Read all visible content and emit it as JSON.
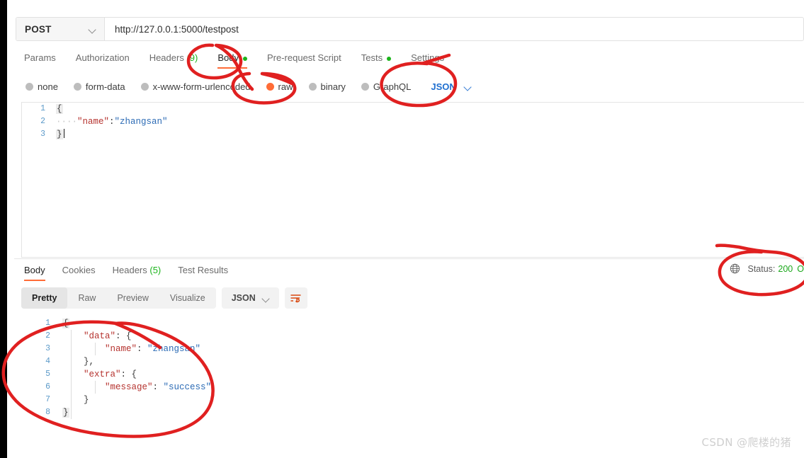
{
  "request": {
    "method": "POST",
    "url": "http://127.0.0.1:5000/testpost",
    "tabs": [
      {
        "label": "Params",
        "active": false,
        "dot": false
      },
      {
        "label": "Authorization",
        "active": false,
        "dot": false
      },
      {
        "label": "Headers",
        "count": "(9)",
        "active": false,
        "dot": false
      },
      {
        "label": "Body",
        "active": true,
        "dot": true
      },
      {
        "label": "Pre-request Script",
        "active": false,
        "dot": false
      },
      {
        "label": "Tests",
        "active": false,
        "dot": true
      },
      {
        "label": "Settings",
        "active": false,
        "dot": false
      }
    ],
    "body_types": [
      {
        "label": "none",
        "selected": false
      },
      {
        "label": "form-data",
        "selected": false
      },
      {
        "label": "x-www-form-urlencoded",
        "selected": false
      },
      {
        "label": "raw",
        "selected": true
      },
      {
        "label": "binary",
        "selected": false
      },
      {
        "label": "GraphQL",
        "selected": false
      }
    ],
    "raw_format": "JSON",
    "editor": {
      "line_numbers": [
        "1",
        "2",
        "3"
      ],
      "lines": [
        {
          "n": "1",
          "open_brace": "{"
        },
        {
          "n": "2",
          "indent_dots": "····",
          "key": "\"name\"",
          "colon": ":",
          "value": "\"zhangsan\""
        },
        {
          "n": "3",
          "close_brace": "}",
          "caret": true
        }
      ]
    }
  },
  "response": {
    "tabs": [
      {
        "label": "Body",
        "active": true
      },
      {
        "label": "Cookies",
        "active": false
      },
      {
        "label": "Headers",
        "count": "(5)",
        "active": false
      },
      {
        "label": "Test Results",
        "active": false
      }
    ],
    "status_label": "Status:",
    "status_code": "200",
    "status_text_partial": "O",
    "viewer": {
      "modes": [
        {
          "label": "Pretty",
          "active": true
        },
        {
          "label": "Raw",
          "active": false
        },
        {
          "label": "Preview",
          "active": false
        },
        {
          "label": "Visualize",
          "active": false
        }
      ],
      "format": "JSON",
      "wrap_icon": "wrap-lines-icon"
    },
    "editor": {
      "line_numbers": [
        "1",
        "2",
        "3",
        "4",
        "5",
        "6",
        "7",
        "8"
      ],
      "lines": [
        {
          "n": "1",
          "text_brace": "{"
        },
        {
          "n": "2",
          "indent": "    ",
          "key": "\"data\"",
          "colon": ": ",
          "brace": "{"
        },
        {
          "n": "3",
          "indent": "        ",
          "key": "\"name\"",
          "colon": ": ",
          "value": "\"zhangsan\""
        },
        {
          "n": "4",
          "indent": "    ",
          "brace": "}",
          "comma": ","
        },
        {
          "n": "5",
          "indent": "    ",
          "key": "\"extra\"",
          "colon": ": ",
          "brace": "{"
        },
        {
          "n": "6",
          "indent": "        ",
          "key": "\"message\"",
          "colon": ": ",
          "value": "\"success\""
        },
        {
          "n": "7",
          "indent": "    ",
          "brace": "}"
        },
        {
          "n": "8",
          "text_brace": "}"
        }
      ]
    }
  },
  "annotations": {
    "color": "#e02020",
    "marks": [
      "body-tab-circle",
      "raw-option-circle",
      "json-format-circle",
      "status-circle",
      "response-body-circle"
    ]
  },
  "watermark": {
    "text": "CSDN @爬楼的猪"
  },
  "colors": {
    "accent": "#ff6c37",
    "link": "#1f6fd0",
    "success": "#1bb41b",
    "annotation": "#e02020"
  }
}
